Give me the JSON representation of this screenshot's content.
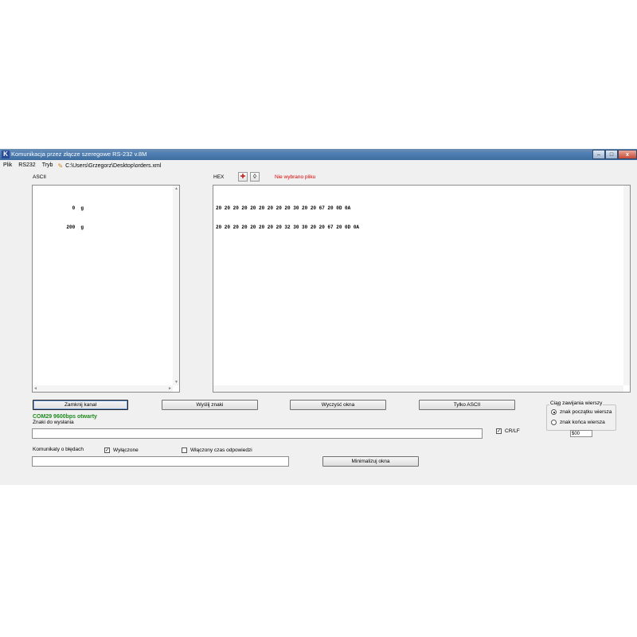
{
  "window": {
    "title": "Komunikacja przez złącze szeregowe RS-232 v.8M",
    "controls": {
      "minimize": "–",
      "maximize": "□",
      "close": "x"
    }
  },
  "menu": {
    "items": [
      "Plik",
      "RS232",
      "Tryb"
    ],
    "file_path": "C:\\Users\\Grzegorz\\Desktop\\orders.xml"
  },
  "ascii_panel": {
    "label": "ASCII",
    "lines": [
      "      0  g",
      "    200  g"
    ]
  },
  "hex_panel": {
    "label": "HEX",
    "file_status": "Nie wybrano pliku",
    "lines": [
      "20 20 20 20 20 20 20 20 20 30 20 20 67 20 0D 0A",
      "20 20 20 20 20 20 20 20 32 30 30 20 20 67 20 0D 0A"
    ]
  },
  "buttons": {
    "close_channel": "Zamknij kanał",
    "send_chars": "Wyślij znaki",
    "clear_windows": "Wyczyść okna",
    "ascii_only": "Tylko ASCII",
    "minimize_windows": "Minimalizuj okna"
  },
  "status": {
    "connection": "COM29 9600bps otwarty",
    "send_label": "Znaki do wysłania",
    "send_value": ""
  },
  "crlf": {
    "label": "CR/LF",
    "checked": true
  },
  "line_end_group": {
    "title": "Ciąg zawijania wierszy",
    "options": [
      "znak początku wiersza",
      "znak końca wiersza"
    ],
    "selected": 0,
    "value": "$00"
  },
  "errors": {
    "label": "Komunikaty o błędach",
    "disabled_label": "Wyłączone",
    "disabled_checked": true,
    "timeout_label": "Włączony czas odpowiedzi",
    "timeout_checked": false,
    "value": ""
  },
  "colors": {
    "status_green": "#1d8a1d",
    "warning_red": "#e00000",
    "title_blue": "#4f7fb3"
  }
}
